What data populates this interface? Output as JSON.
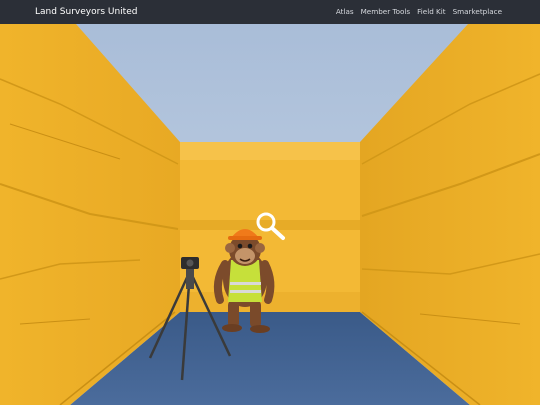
{
  "nav": {
    "brand": "Land Surveyors United",
    "links": [
      {
        "label": "Atlas"
      },
      {
        "label": "Member Tools"
      },
      {
        "label": "Field Kit"
      },
      {
        "label": "Smarketplace"
      }
    ]
  },
  "colors": {
    "navbar": "#2b2f37",
    "wall": "#f2b731",
    "floor": "#3f5f8f",
    "sky": "#b0c3dc"
  },
  "hero": {
    "scene": "yellow-room-monkey-surveyor",
    "icons": [
      "magnifier-icon",
      "tripod-icon"
    ]
  }
}
